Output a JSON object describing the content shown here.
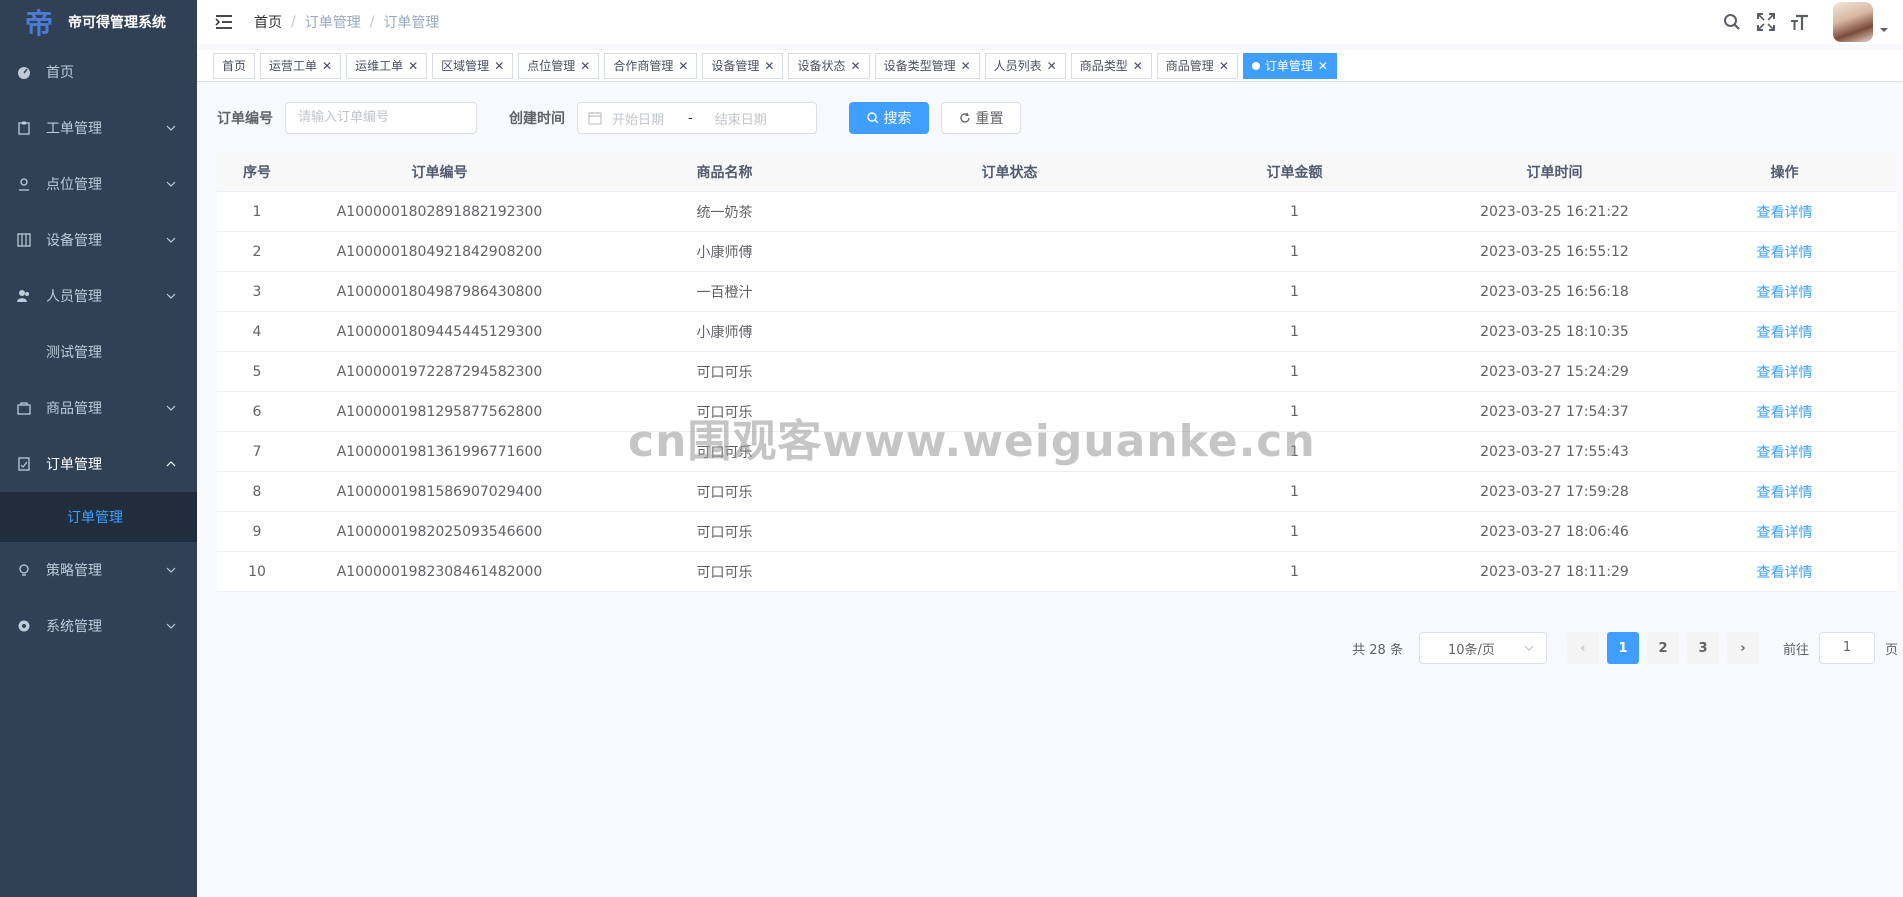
{
  "app": {
    "title": "帝可得管理系统",
    "logo_glyph": "帝"
  },
  "sidebar": {
    "items": [
      {
        "label": "首页",
        "icon": "dashboard-icon"
      },
      {
        "label": "工单管理",
        "icon": "clipboard-icon"
      },
      {
        "label": "点位管理",
        "icon": "location-icon"
      },
      {
        "label": "设备管理",
        "icon": "device-icon"
      },
      {
        "label": "人员管理",
        "icon": "people-icon"
      },
      {
        "label": "测试管理",
        "icon": ""
      },
      {
        "label": "商品管理",
        "icon": "bag-icon"
      },
      {
        "label": "订单管理",
        "icon": "order-icon"
      },
      {
        "label": "策略管理",
        "icon": "bulb-icon"
      },
      {
        "label": "系统管理",
        "icon": "gear-icon"
      }
    ],
    "sub_item": "订单管理"
  },
  "breadcrumb": [
    "首页",
    "订单管理",
    "订单管理"
  ],
  "breadcrumb_sep": "/",
  "tags": [
    "首页",
    "运营工单",
    "运维工单",
    "区域管理",
    "点位管理",
    "合作商管理",
    "设备管理",
    "设备状态",
    "设备类型管理",
    "人员列表",
    "商品类型",
    "商品管理",
    "订单管理"
  ],
  "filter": {
    "order_no_label": "订单编号",
    "order_no_placeholder": "请输入订单编号",
    "created_label": "创建时间",
    "start_placeholder": "开始日期",
    "range_sep": "-",
    "end_placeholder": "结束日期",
    "search_label": "搜索",
    "reset_label": "重置"
  },
  "table": {
    "columns": [
      "序号",
      "订单编号",
      "商品名称",
      "订单状态",
      "订单金额",
      "订单时间",
      "操作"
    ],
    "action_label": "查看详情",
    "rows": [
      [
        "1",
        "A100000180289188219230​0",
        "统一奶茶",
        "",
        "1",
        "2023-03-25 16:21:22"
      ],
      [
        "2",
        "A1000001804921842908200",
        "小康师傅",
        "",
        "1",
        "2023-03-25 16:55:12"
      ],
      [
        "3",
        "A1000001804987986430800",
        "一百橙汁",
        "",
        "1",
        "2023-03-25 16:56:18"
      ],
      [
        "4",
        "A1000001809445445129300",
        "小康师傅",
        "",
        "1",
        "2023-03-25 18:10:35"
      ],
      [
        "5",
        "A1000001972287294582300",
        "可口可乐",
        "",
        "1",
        "2023-03-27 15:24:29"
      ],
      [
        "6",
        "A1000001981295877562800",
        "可口可乐",
        "",
        "1",
        "2023-03-27 17:54:37"
      ],
      [
        "7",
        "A1000001981361996771600",
        "可口可乐",
        "",
        "1",
        "2023-03-27 17:55:43"
      ],
      [
        "8",
        "A1000001981586907029400",
        "可口可乐",
        "",
        "1",
        "2023-03-27 17:59:28"
      ],
      [
        "9",
        "A1000001982025093546600",
        "可口可乐",
        "",
        "1",
        "2023-03-27 18:06:46"
      ],
      [
        "10",
        "A1000001982308461482000",
        "可口可乐",
        "",
        "1",
        "2023-03-27 18:11:29"
      ]
    ]
  },
  "pagination": {
    "total_text": "共 28 条",
    "page_size": "10条/页",
    "pages": [
      "1",
      "2",
      "3"
    ],
    "current": "1",
    "prev": "‹",
    "next": "›",
    "goto_label": "前往",
    "goto_value": "1",
    "page_unit": "页"
  },
  "watermark": "cn围观客www.weiguanke.cn",
  "colors": {
    "sidebar_bg": "#304156",
    "submenu_bg": "#1f2d3d",
    "primary": "#409eff"
  }
}
